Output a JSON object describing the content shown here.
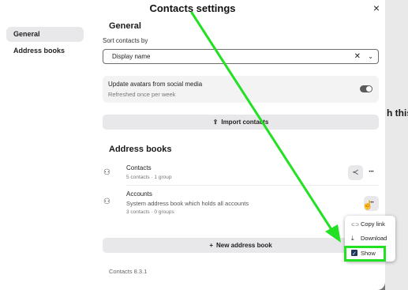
{
  "dialog": {
    "title": "Contacts settings",
    "close_icon": "close-icon",
    "close_glyph": "×"
  },
  "nav": {
    "items": [
      {
        "label": "General",
        "active": true
      },
      {
        "label": "Address books",
        "active": false
      }
    ]
  },
  "general": {
    "heading": "General",
    "sort_label": "Sort contacts by",
    "sort_value": "Display name",
    "clear_glyph": "✕",
    "chevron_glyph": "⌄",
    "avatar_title": "Update avatars from social media",
    "avatar_subtitle": "Refreshed once per week",
    "avatar_toggle_on": true,
    "import_button": "Import contacts",
    "import_icon_glyph": "⇪"
  },
  "address_books": {
    "heading": "Address books",
    "books": [
      {
        "name": "Contacts",
        "description": "",
        "meta": "5 contacts · 1 group",
        "icon": "people-plus-icon",
        "icon_glyph": "⚇"
      },
      {
        "name": "Accounts",
        "description": "System address book which holds all accounts",
        "meta": "3 contacts · 0 groups",
        "icon": "people-plus-icon",
        "icon_glyph": "⚇"
      }
    ],
    "share_glyph": "≺",
    "more_glyph": "•••",
    "new_button": "New address book",
    "new_icon_glyph": "+"
  },
  "version": "Contacts 8.3.1",
  "background_text": "h this",
  "context_menu": {
    "items": [
      {
        "label": "Copy link",
        "icon": "link-icon",
        "glyph": "⊂⊃"
      },
      {
        "label": "Download",
        "icon": "download-icon",
        "glyph": "⤓"
      },
      {
        "label": "Show",
        "icon": "checkbox-icon",
        "checked": true
      }
    ]
  },
  "annotation": {
    "arrow_color": "#22e022"
  }
}
